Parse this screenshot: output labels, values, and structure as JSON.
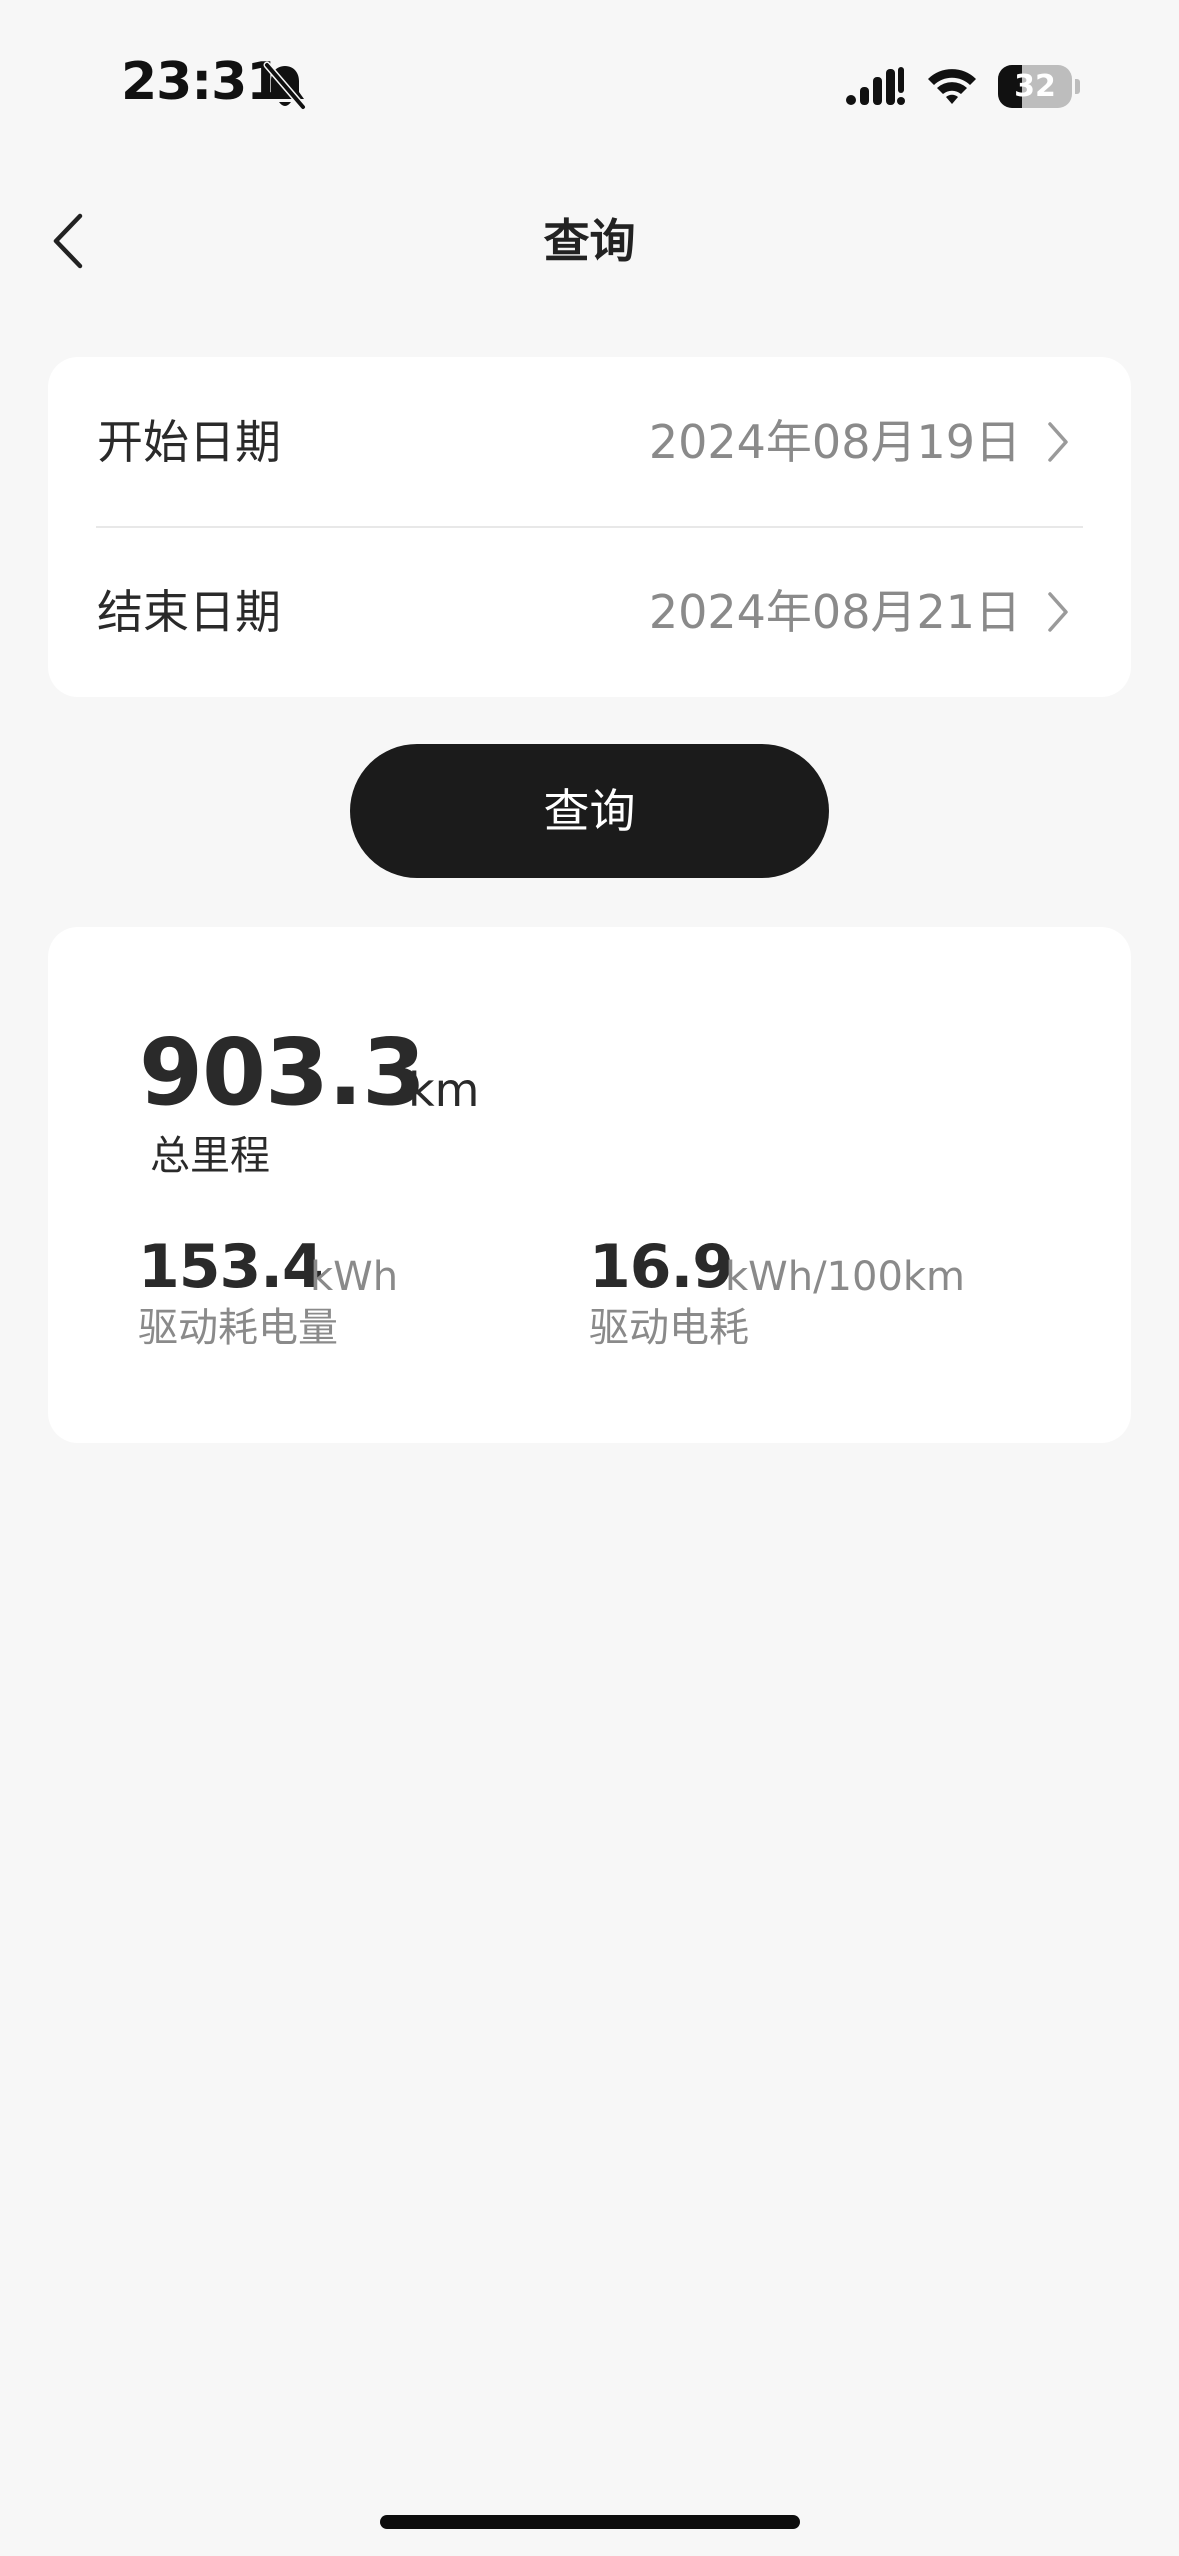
{
  "status_bar": {
    "time": "23:31",
    "battery_level": "32",
    "icons": [
      "bell-off-icon",
      "signal-icon",
      "wifi-icon",
      "battery-icon"
    ]
  },
  "nav": {
    "back_icon": "chevron-left-icon",
    "title": "查询"
  },
  "date_range": {
    "start": {
      "label": "开始日期",
      "value": "2024年08月19日"
    },
    "end": {
      "label": "结束日期",
      "value": "2024年08月21日"
    }
  },
  "query_button": {
    "label": "查询"
  },
  "stats": {
    "total_distance": {
      "value": "903.3",
      "unit": "km",
      "label": "总里程"
    },
    "drive_energy": {
      "value": "153.4",
      "unit": "kWh",
      "label": "驱动耗电量"
    },
    "drive_consumption": {
      "value": "16.9",
      "unit": "kWh/100km",
      "label": "驱动电耗"
    }
  },
  "colors": {
    "background": "#f7f7f7",
    "card": "#ffffff",
    "primary_text": "#2a2a2a",
    "secondary_text": "#8a8a8a",
    "button": "#1b1b1b"
  }
}
